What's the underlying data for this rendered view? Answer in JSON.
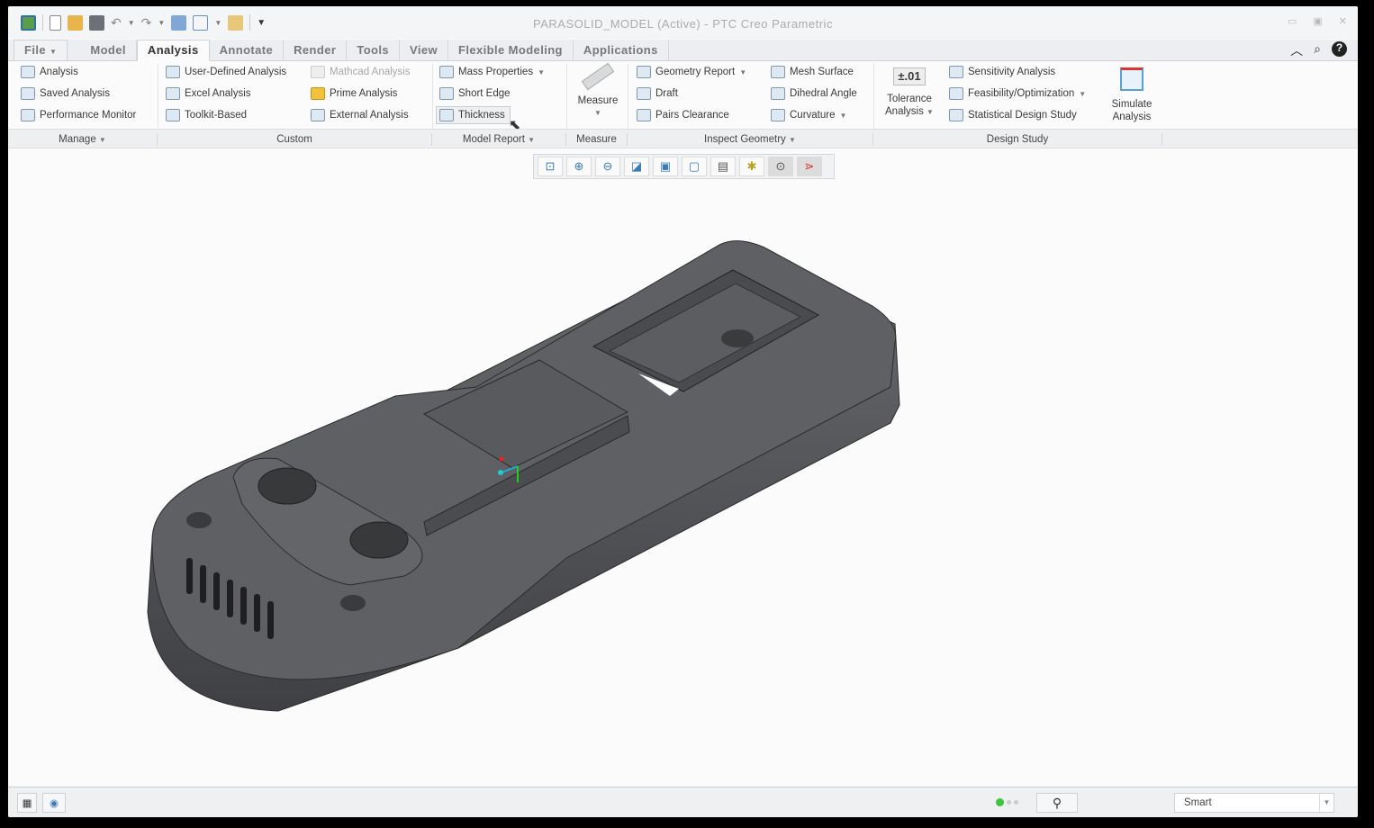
{
  "window": {
    "title": "PARASOLID_MODEL (Active) - PTC Creo Parametric"
  },
  "quick_access": [
    "app-icon",
    "new-icon",
    "open-icon",
    "save-icon",
    "undo-icon",
    "redo-icon",
    "regenerate-icon",
    "windows-icon",
    "close-window-icon",
    "customize-icon"
  ],
  "tabs": [
    {
      "label": "File"
    },
    {
      "label": "Model"
    },
    {
      "label": "Analysis"
    },
    {
      "label": "Annotate"
    },
    {
      "label": "Render"
    },
    {
      "label": "Tools"
    },
    {
      "label": "View"
    },
    {
      "label": "Flexible Modeling"
    },
    {
      "label": "Applications"
    }
  ],
  "active_tab": "Analysis",
  "ribbon": {
    "manage": {
      "label": "Manage",
      "items": [
        "Analysis",
        "Saved Analysis",
        "Performance Monitor"
      ]
    },
    "custom": {
      "label": "Custom",
      "items": [
        "User-Defined Analysis",
        "Excel Analysis",
        "Toolkit-Based",
        "Mathcad Analysis",
        "Prime Analysis",
        "External Analysis"
      ]
    },
    "model_report": {
      "label": "Model Report",
      "items": [
        "Mass Properties",
        "Short Edge",
        "Thickness"
      ]
    },
    "measure": {
      "label": "Measure",
      "button": "Measure"
    },
    "inspect_geometry": {
      "label": "Inspect Geometry",
      "items": [
        "Geometry Report",
        "Draft",
        "Pairs Clearance",
        "Mesh Surface",
        "Dihedral Angle",
        "Curvature"
      ]
    },
    "design_study": {
      "label": "Design Study",
      "tolerance_icon": "±.01",
      "tolerance_line1": "Tolerance",
      "tolerance_line2": "Analysis",
      "items": [
        "Sensitivity Analysis",
        "Feasibility/Optimization",
        "Statistical Design Study"
      ],
      "simulate_line1": "Simulate",
      "simulate_line2": "Analysis"
    }
  },
  "view_toolbar": [
    "refit-icon",
    "zoom-in-icon",
    "zoom-out-icon",
    "repaint-icon",
    "display-style-icon",
    "saved-orientations-icon",
    "view-manager-icon",
    "datum-display-icon",
    "spin-center-icon",
    "annotation-display-icon"
  ],
  "status": {
    "selection_filter": "Smart"
  },
  "colors": {
    "model": "#5a5b5e",
    "accent": "#3a7bb8",
    "status_green": "#3cc43c"
  }
}
